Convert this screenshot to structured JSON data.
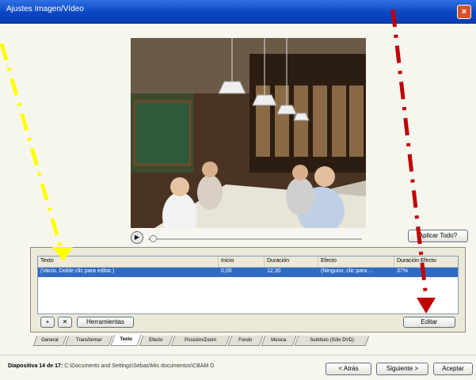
{
  "window": {
    "title": "Ajustes Imagen/Vídeo",
    "close_label": "×"
  },
  "player": {
    "play_label": "▶"
  },
  "actions": {
    "apply_all_label": "Aplicar Todo?"
  },
  "grid": {
    "columns": [
      "Texto",
      "Inicio",
      "Duración",
      "Efecto",
      "Duración Efecto"
    ],
    "rows": [
      [
        "(Vacío. Doble clic para editar.)",
        "0,00",
        "12,30",
        "(Ninguno, clic para ...",
        "37%"
      ]
    ]
  },
  "panel": {
    "add_label": "+",
    "remove_label": "✕",
    "tools_label": "Herramientas",
    "edit_label": "Editar"
  },
  "tabs": [
    "General",
    "Transformar",
    "Texto",
    "Efecto",
    "Posición/Zoom",
    "Fondo",
    "Música",
    "Subtítulo (Sólo DVD)"
  ],
  "active_tab": "Texto",
  "status": {
    "slide_label": "Diapositiva 14 de 17:",
    "path": "C:\\Documents and Settings\\Sebas\\Mis documentos\\CBAM D"
  },
  "nav": {
    "back_label": "< Atrás",
    "next_label": "Siguiente >",
    "ok_label": "Aceptar"
  },
  "colors": {
    "title_bar": "#0a46c4",
    "selection": "#316ac5",
    "yellow_arrow": "#ffff00",
    "red_arrow": "#c00000"
  }
}
